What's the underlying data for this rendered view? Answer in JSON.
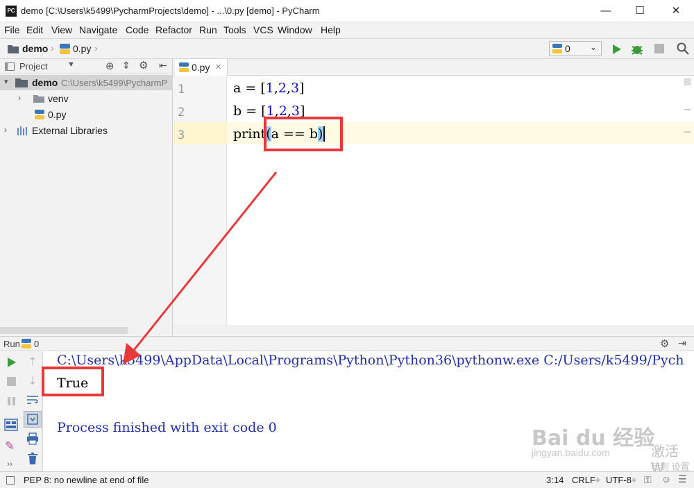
{
  "window": {
    "title": "demo [C:\\Users\\k5499\\PycharmProjects\\demo] - ...\\0.py [demo] - PyCharm",
    "app_icon_text": "PC",
    "minimize": "—",
    "maximize": "☐",
    "close": "✕"
  },
  "menu": [
    "File",
    "Edit",
    "View",
    "Navigate",
    "Code",
    "Refactor",
    "Run",
    "Tools",
    "VCS",
    "Window",
    "Help"
  ],
  "navbar": {
    "breadcrumbs": [
      "demo",
      "0.py"
    ],
    "run_config": "0"
  },
  "project_panel": {
    "title": "Project",
    "root_name": "demo",
    "root_path": "C:\\Users\\k5499\\PycharmP",
    "items": [
      "venv",
      "0.py"
    ],
    "external": "External Libraries"
  },
  "editor": {
    "tab": "0.py",
    "line_numbers": [
      "1",
      "2",
      "3"
    ],
    "lines": [
      {
        "var": "a",
        "nums": [
          "1",
          "2",
          "3"
        ]
      },
      {
        "var": "b",
        "nums": [
          "1",
          "2",
          "3"
        ]
      }
    ],
    "line3": {
      "fn": "print",
      "open": "(",
      "body": "a == b",
      "close": ")"
    }
  },
  "run_panel": {
    "label": "Run",
    "config": "0",
    "command": "C:\\Users\\k5499\\AppData\\Local\\Programs\\Python\\Python36\\pythonw.exe C:/Users/k5499/Pych",
    "output": "True",
    "exit_message": "Process finished with exit code 0"
  },
  "watermark": {
    "brand": "Bai  du 经验",
    "url": "jingyan.baidu.com",
    "activate": "激活 W",
    "activate_sub": "转到 设置"
  },
  "status": {
    "message": "PEP 8: no newline at end of file",
    "position": "3:14",
    "line_sep": "CRLF÷",
    "encoding": "UTF-8÷"
  },
  "colors": {
    "accent_red": "#e8383a",
    "output_blue": "#1f2eaa",
    "number_blue": "#0a0ad0",
    "run_green": "#3a9d3a",
    "current_line": "#fffae3"
  }
}
